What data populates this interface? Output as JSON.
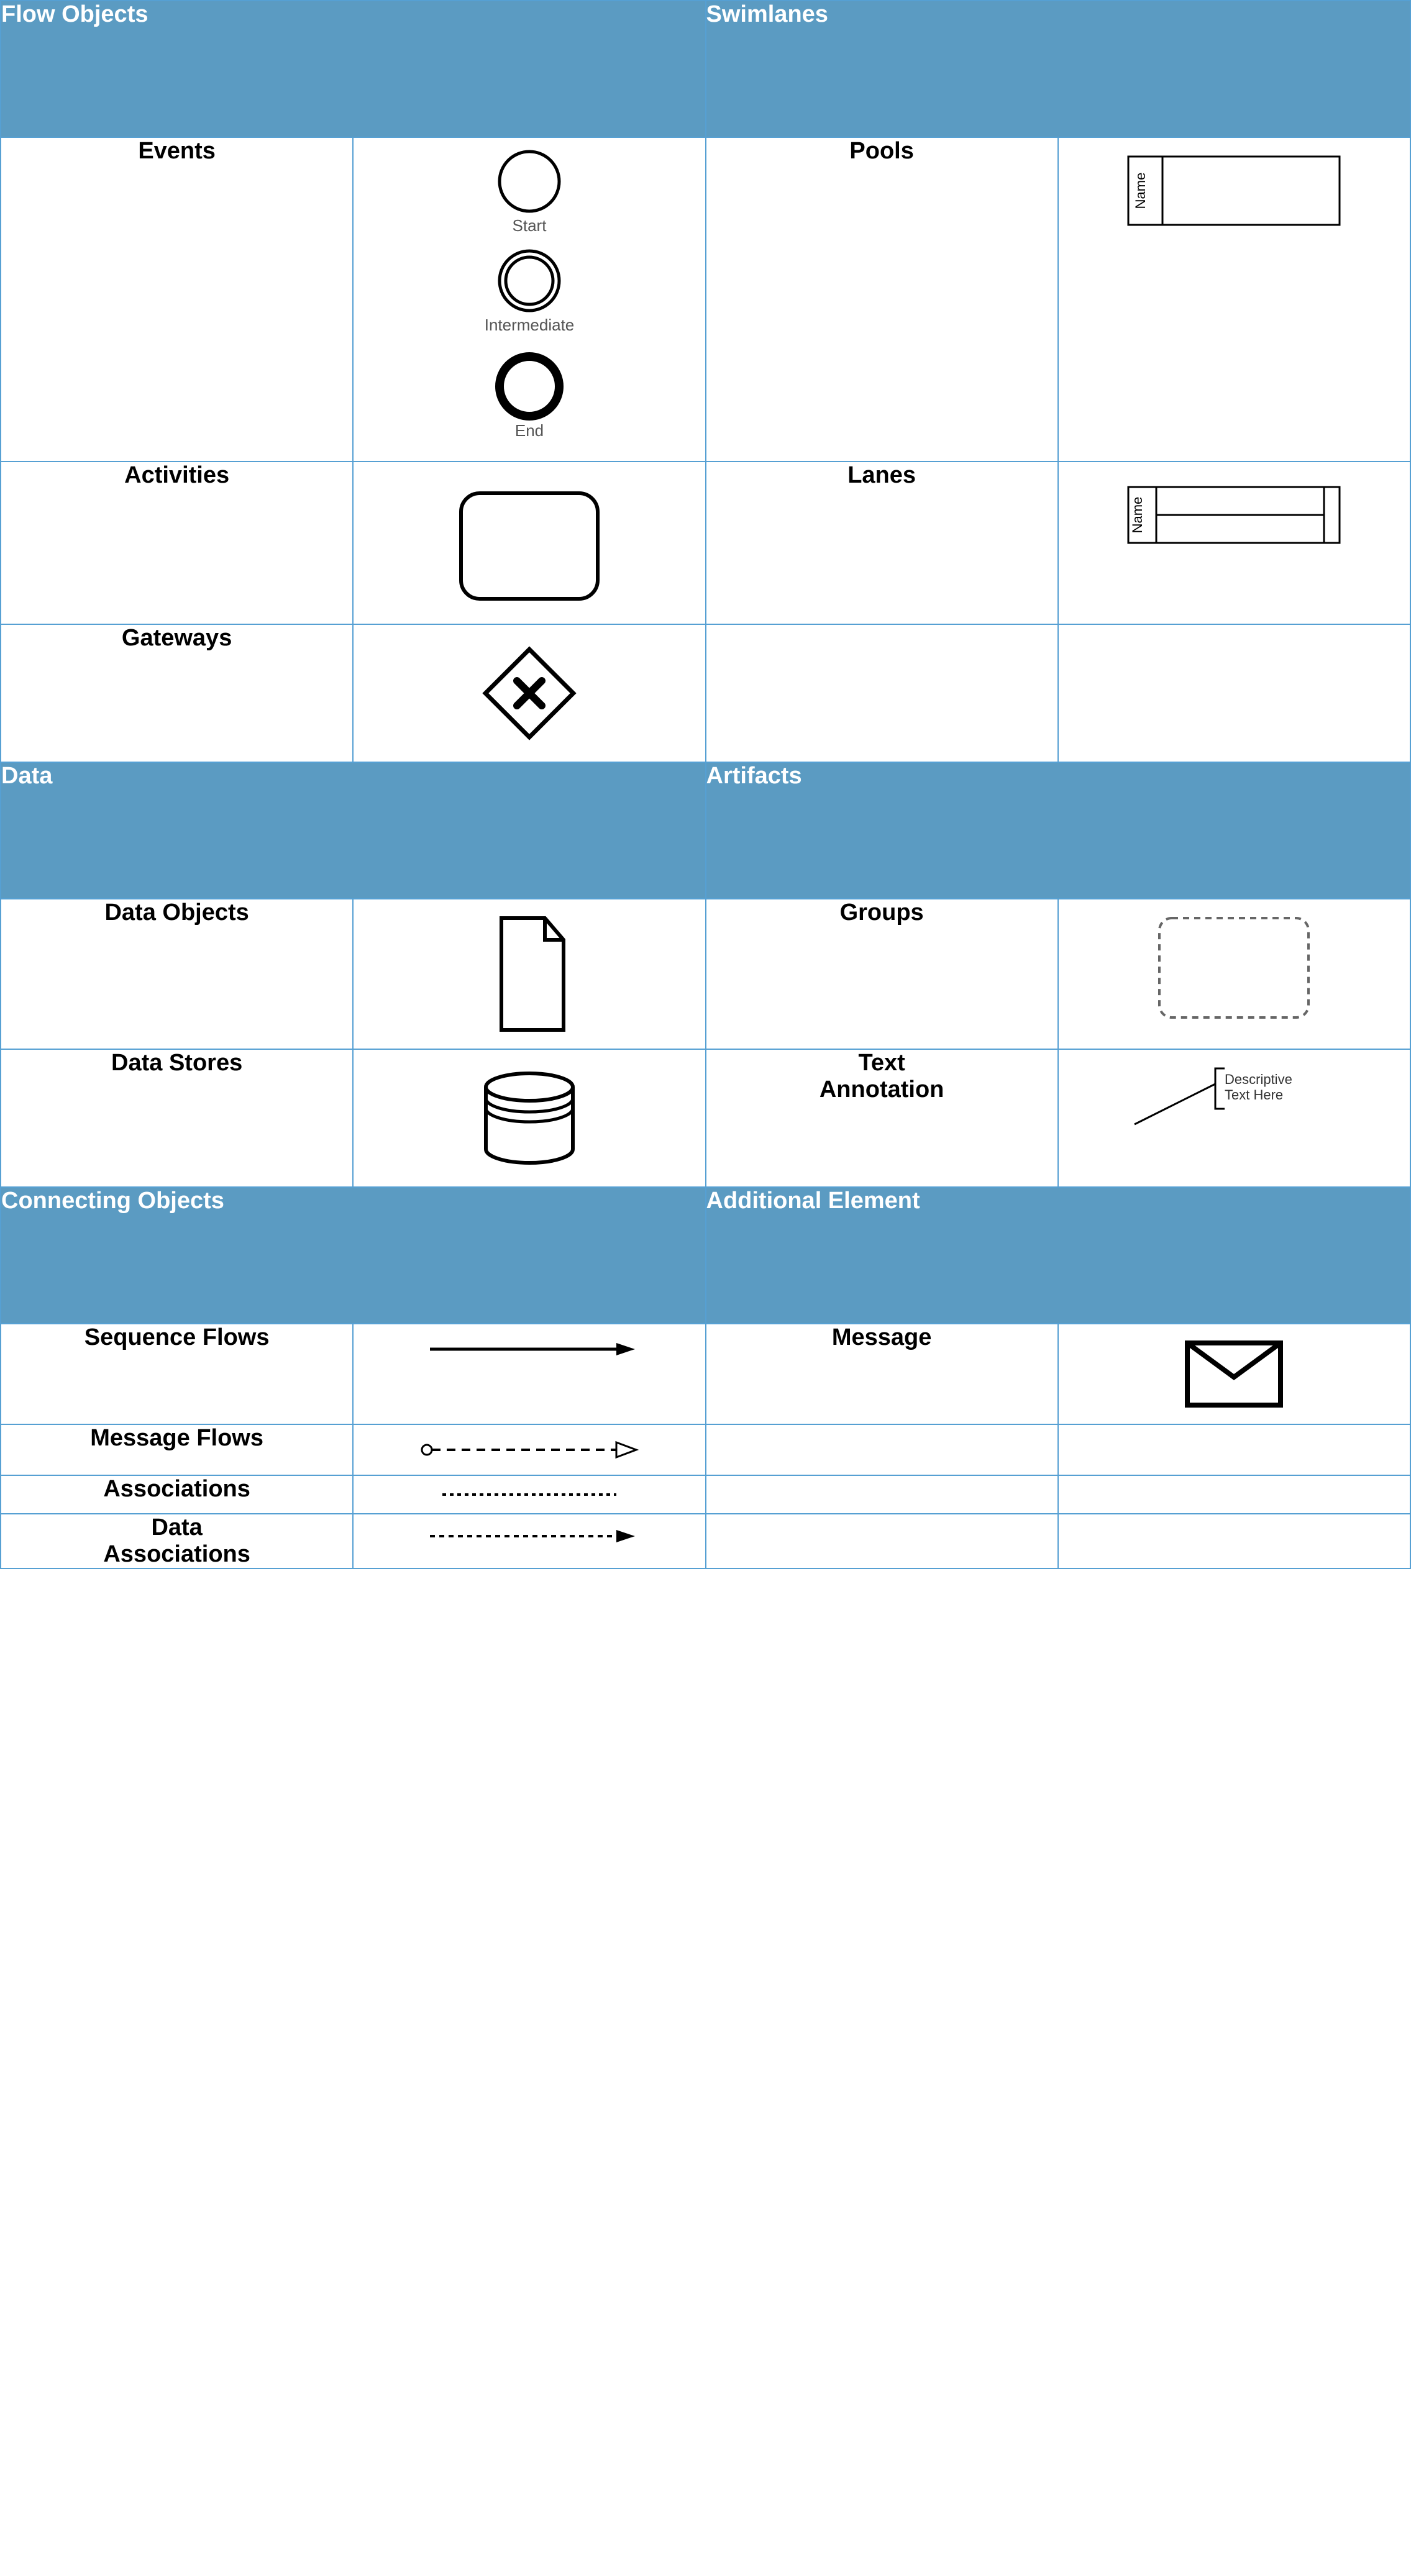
{
  "sections": {
    "flow_objects": {
      "title": "Flow Objects"
    },
    "swimlanes": {
      "title": "Swimlanes"
    },
    "data": {
      "title": "Data"
    },
    "artifacts": {
      "title": "Artifacts"
    },
    "connecting": {
      "title": "Connecting Objects"
    },
    "additional": {
      "title": "Additional Element"
    }
  },
  "rows": {
    "events": {
      "label": "Events",
      "captions": {
        "start": "Start",
        "intermediate": "Intermediate",
        "end": "End"
      }
    },
    "activities": {
      "label": "Activities"
    },
    "gateways": {
      "label": "Gateways"
    },
    "pools": {
      "label": "Pools",
      "name_text": "Name"
    },
    "lanes": {
      "label": "Lanes",
      "name_text": "Name"
    },
    "data_objects": {
      "label": "Data Objects"
    },
    "data_stores": {
      "label": "Data Stores"
    },
    "groups": {
      "label": "Groups"
    },
    "text_annotation": {
      "label": "Text\nAnnotation",
      "annotation_text1": "Descriptive",
      "annotation_text2": "Text Here"
    },
    "sequence_flows": {
      "label": "Sequence Flows"
    },
    "message_flows": {
      "label": "Message Flows"
    },
    "associations": {
      "label": "Associations"
    },
    "data_associations": {
      "label": "Data\nAssociations"
    },
    "message": {
      "label": "Message"
    }
  }
}
